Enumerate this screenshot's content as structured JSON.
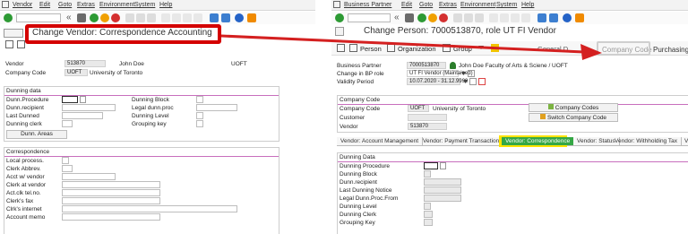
{
  "left": {
    "menu": [
      "Vendor",
      "Edit",
      "Goto",
      "Extras",
      "Environment",
      "System",
      "Help"
    ],
    "title": "Change Vendor: Correspondence Accounting",
    "header_fields": [
      {
        "label": "Vendor",
        "value": "513870",
        "name": "John Doe",
        "extra": "UOFT"
      },
      {
        "label": "Company Code",
        "value": "UOFT",
        "name": "University of Toronto"
      }
    ],
    "dunning": {
      "title": "Dunning data",
      "left_labels": [
        "Dunn.Procedure",
        "Dunn.recipient",
        "Last Dunned",
        "Dunning clerk"
      ],
      "right_labels": [
        "Dunning Block",
        "Legal dunn.proc",
        "Dunning Level",
        "Grouping key"
      ],
      "button": "Dunn. Areas"
    },
    "correspondence": {
      "title": "Correspondence",
      "labels": [
        "Local process.",
        "Clerk Abbrev.",
        "Acct w/ vendor",
        "Clerk at vendor",
        "Act.clk tel.no.",
        "Clerk's fax",
        "Clrk's internet",
        "Account memo"
      ]
    }
  },
  "right": {
    "menu": [
      "Business Partner",
      "Edit",
      "Goto",
      "Extras",
      "Environment",
      "System",
      "Help"
    ],
    "title": "Change Person: 7000513870, role UT FI Vendor",
    "nav_tabs": [
      "Person",
      "Organization",
      "Group"
    ],
    "nav_more": "General D",
    "callout_labels": [
      "Company Code",
      "Purchasing"
    ],
    "bp_fields": [
      {
        "label": "Business Partner",
        "value": "7000513870",
        "desc": "John Doe Faculty of Arts & Sciene / UOFT"
      },
      {
        "label": "Change in BP role",
        "value": "UT FI Vendor (Maintained)"
      },
      {
        "label": "Validity Period",
        "value": "10.07.2020 - 31.12.9999"
      }
    ],
    "company_code": {
      "title": "Company Code",
      "rows": [
        {
          "label": "Company Code",
          "value": "UOFT",
          "desc": "University of Toronto"
        },
        {
          "label": "Customer",
          "value": ""
        },
        {
          "label": "Vendor",
          "value": "513870"
        }
      ],
      "btn_codes": "Company Codes",
      "btn_switch": "Switch Company Code"
    },
    "tabs": [
      "Vendor: Account Management",
      "Vendor: Payment Transactions",
      "Vendor: Correspondence",
      "Vendor: Status",
      "Vendor: Withholding Tax",
      "V"
    ],
    "dunning": {
      "title": "Dunning Data",
      "labels": [
        "Dunning Procedure",
        "Dunning Block",
        "Dunn.recipient",
        "Last Dunning Notice",
        "Legal Dunn.Proc.From",
        "Dunning Level",
        "Dunning Clerk",
        "Grouping Key"
      ]
    }
  },
  "colors": {
    "highlight_red": "#d40000",
    "tab_yellow": "#ffe300",
    "tab_green": "#35a745",
    "arrow": "#d42020"
  }
}
